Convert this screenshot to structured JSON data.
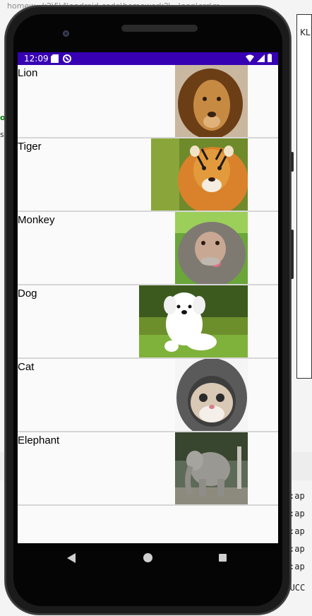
{
  "ide": {
    "top_path": "homew...k2\\5\\4\\android-code\\homework2\\...\\app\\src\\m...",
    "right_tab": "KL",
    "side_frag_1": "o:",
    "side_frag_2": "s",
    "console_lines": [
      ":ap",
      ":ap",
      ":ap",
      ":ap",
      ":ap"
    ],
    "build_text": "BUILD SUCC"
  },
  "statusbar": {
    "time": "12:09",
    "bg_color": "#3700b3"
  },
  "animals": [
    {
      "name": "Lion",
      "image": "lion-photo"
    },
    {
      "name": "Tiger",
      "image": "tiger-photo"
    },
    {
      "name": "Monkey",
      "image": "monkey-photo"
    },
    {
      "name": "Dog",
      "image": "dog-photo"
    },
    {
      "name": "Cat",
      "image": "cat-photo"
    },
    {
      "name": "Elephant",
      "image": "elephant-photo"
    }
  ],
  "navbar": {
    "back_icon": "back-triangle-icon",
    "home_icon": "home-circle-icon",
    "recents_icon": "recents-square-icon"
  }
}
